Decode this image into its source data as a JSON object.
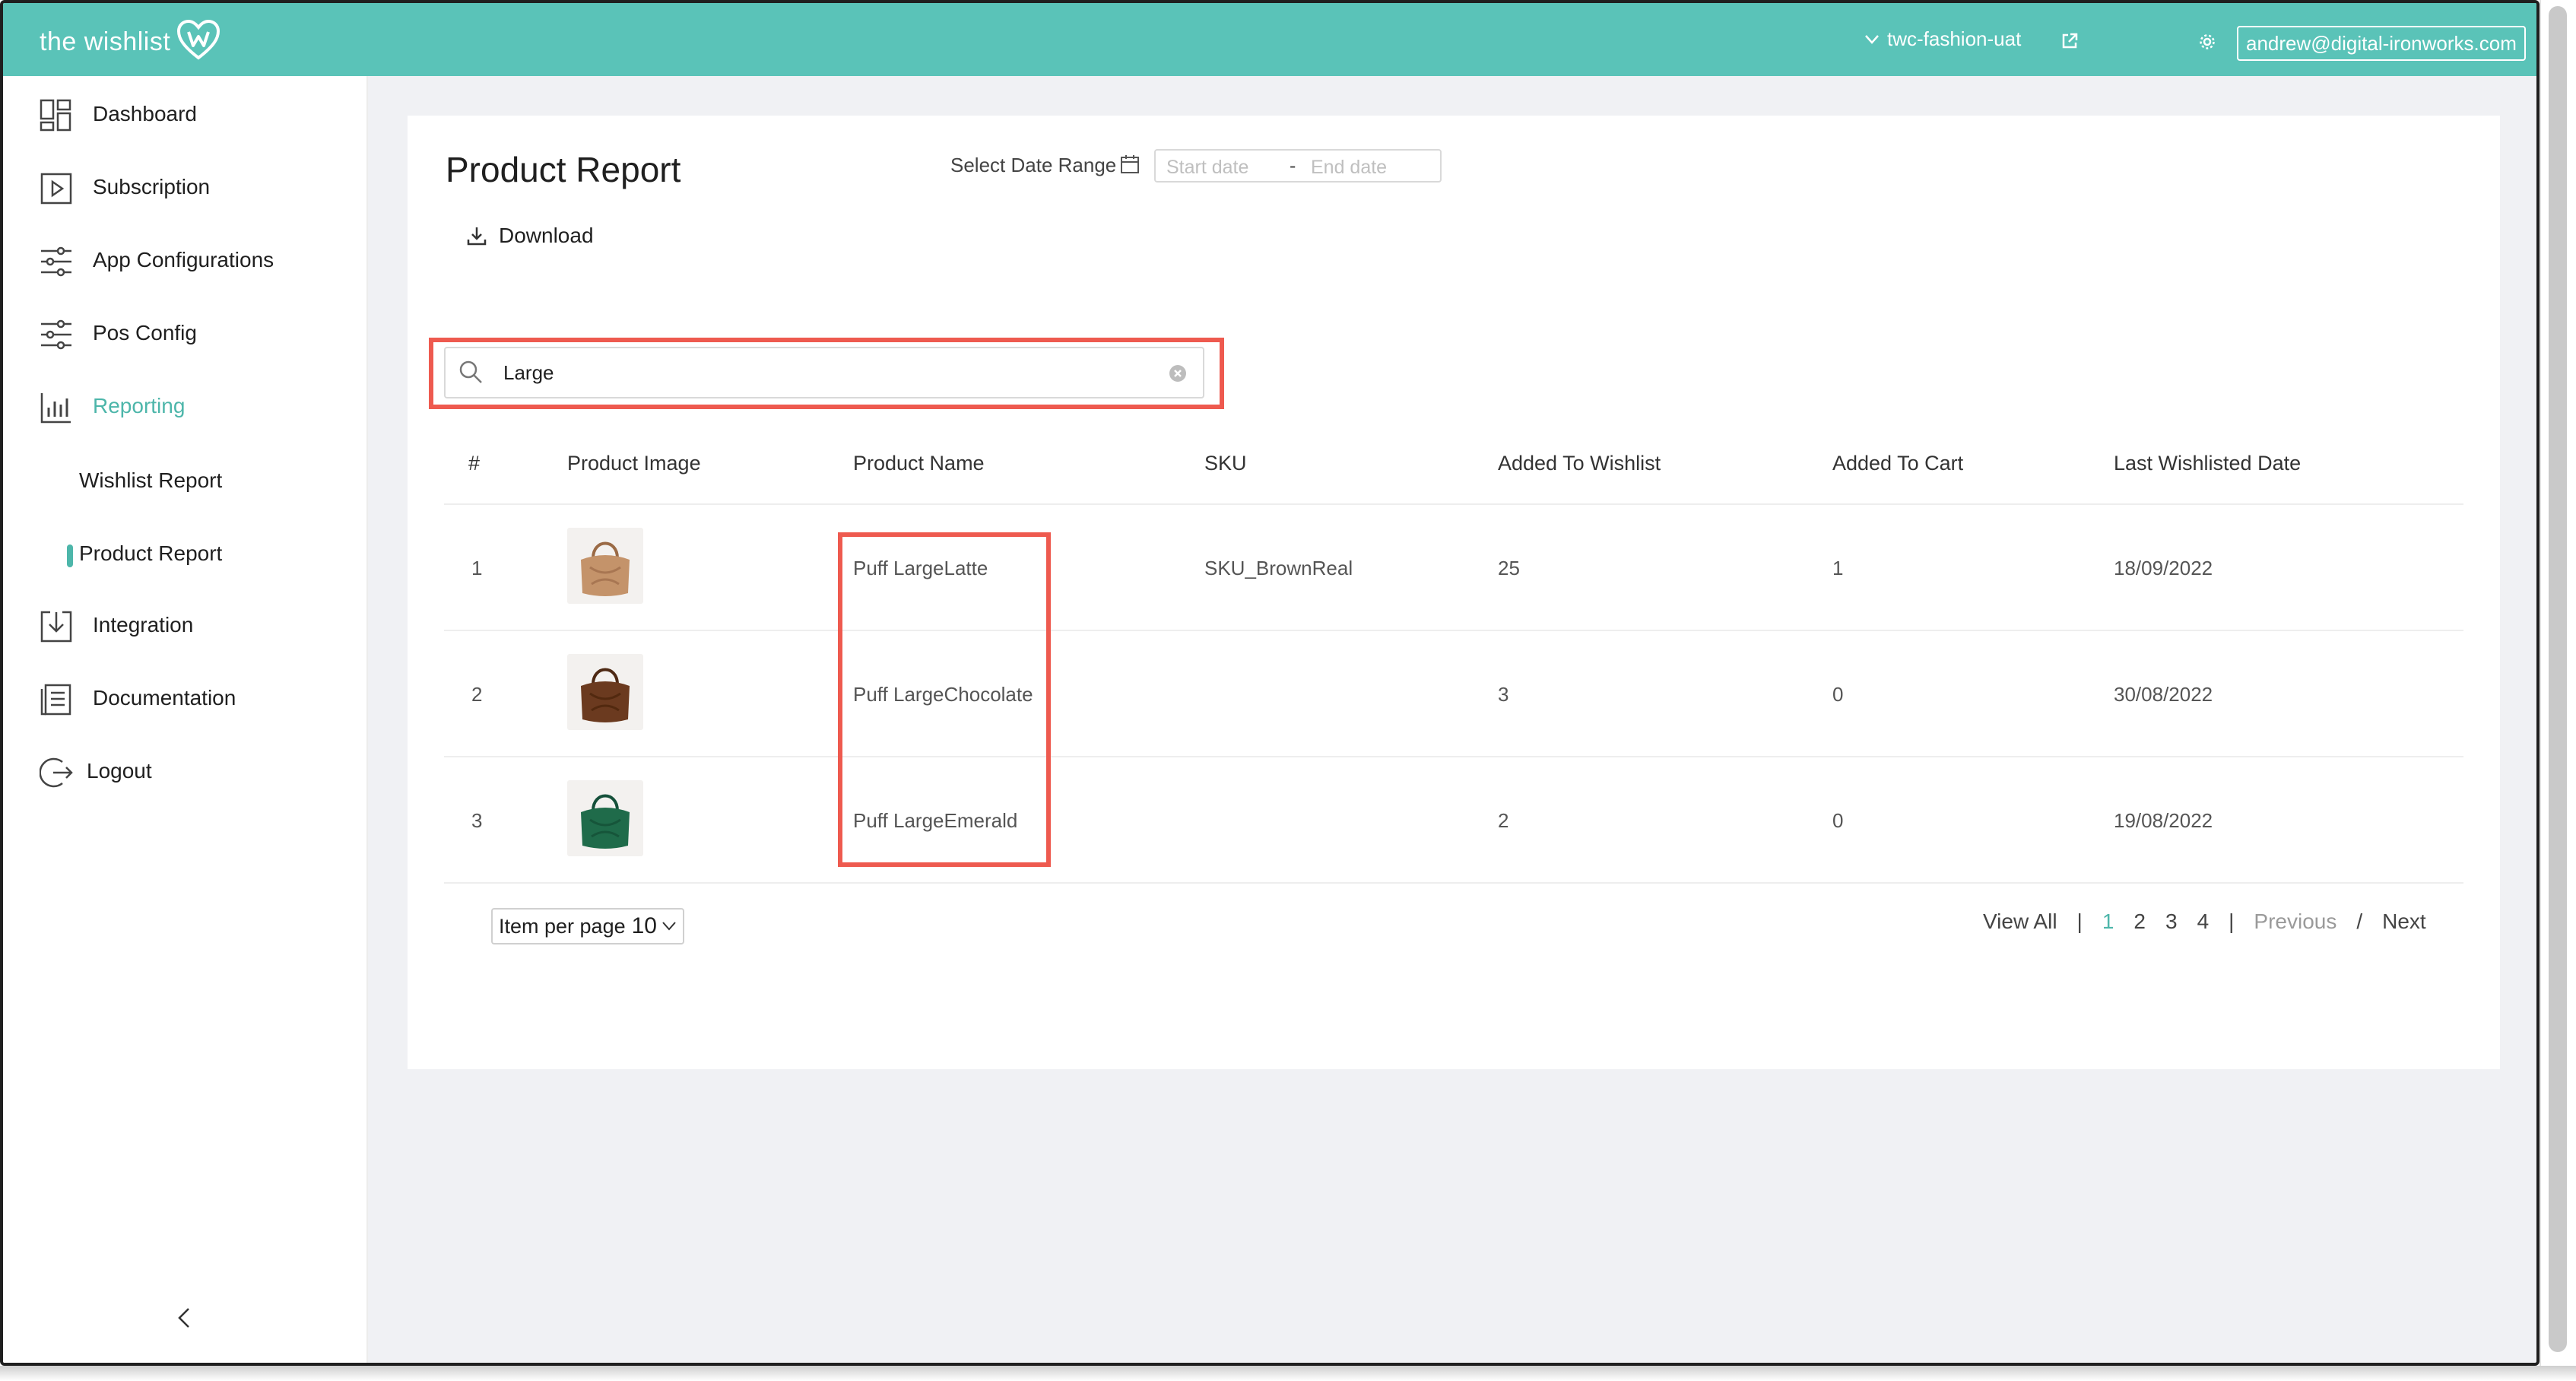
{
  "header": {
    "logo_text": "the wishlist",
    "store_name": "twc-fashion-uat",
    "user_email": "andrew@digital-ironworks.com"
  },
  "sidebar": {
    "items": [
      {
        "label": "Dashboard",
        "icon": "dashboard-icon"
      },
      {
        "label": "Subscription",
        "icon": "play-square-icon"
      },
      {
        "label": "App Configurations",
        "icon": "sliders-icon"
      },
      {
        "label": "Pos Config",
        "icon": "sliders-icon"
      },
      {
        "label": "Reporting",
        "icon": "bar-chart-icon",
        "active": true
      },
      {
        "label": "Integration",
        "icon": "import-icon"
      },
      {
        "label": "Documentation",
        "icon": "document-icon"
      },
      {
        "label": "Logout",
        "icon": "logout-icon"
      }
    ],
    "sub_items": [
      {
        "label": "Wishlist Report"
      },
      {
        "label": "Product Report",
        "active": true
      }
    ]
  },
  "page": {
    "title": "Product Report",
    "date_range_label": "Select Date Range",
    "start_placeholder": "Start date",
    "end_placeholder": "End date",
    "date_separator": "-",
    "download_label": "Download"
  },
  "search": {
    "value": "Large"
  },
  "table": {
    "headers": [
      "#",
      "Product Image",
      "Product Name",
      "SKU",
      "Added To Wishlist",
      "Added To Cart",
      "Last Wishlisted Date"
    ],
    "rows": [
      {
        "index": "1",
        "image": "tan-handbag",
        "name": "Puff LargeLatte",
        "sku": "SKU_BrownReal",
        "wishlist": "25",
        "cart": "1",
        "date": "18/09/2022"
      },
      {
        "index": "2",
        "image": "brown-handbag",
        "name": "Puff LargeChocolate",
        "sku": "",
        "wishlist": "3",
        "cart": "0",
        "date": "30/08/2022"
      },
      {
        "index": "3",
        "image": "green-handbag",
        "name": "Puff LargeEmerald",
        "sku": "",
        "wishlist": "2",
        "cart": "0",
        "date": "19/08/2022"
      }
    ]
  },
  "footer": {
    "per_page_label": "Item per page",
    "per_page_value": "10",
    "view_all": "View All",
    "pages": [
      "1",
      "2",
      "3",
      "4"
    ],
    "current_page": "1",
    "previous": "Previous",
    "next": "Next",
    "divider": "|",
    "slash": "/"
  },
  "colors": {
    "brand": "#5ac3b8",
    "accent": "#4db6aa",
    "highlight": "#ee5a4f",
    "bag_tan": "#c4936a",
    "bag_brown": "#6b3a1f",
    "bag_green": "#1f6b4a"
  }
}
